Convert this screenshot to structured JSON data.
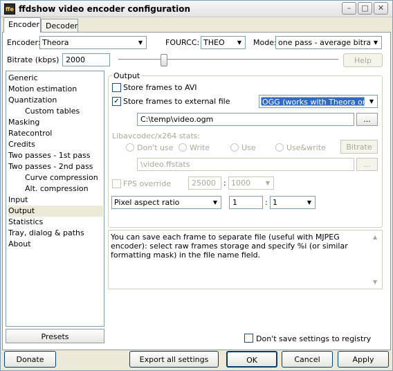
{
  "window": {
    "title": "ffdshow video encoder configuration",
    "icon_text": "ffe"
  },
  "tabs": [
    "Encoder",
    "Decoder"
  ],
  "encoder": {
    "label": "Encoder:",
    "value": "Theora"
  },
  "fourcc": {
    "label": "FOURCC:",
    "value": "THEO"
  },
  "mode": {
    "label": "Mode:",
    "value": "one pass - average bitrate"
  },
  "bitrate": {
    "label": "Bitrate (kbps)",
    "value": "2000",
    "help_label": "Help"
  },
  "tree": [
    "Generic",
    "Motion estimation",
    "Quantization",
    "Custom tables",
    "Masking",
    "Ratecontrol",
    "Credits",
    "Two passes - 1st pass",
    "Two passes - 2nd pass",
    "Curve compression",
    "Alt. compression",
    "Input",
    "Output",
    "Statistics",
    "Tray, dialog & paths",
    "About"
  ],
  "presets_label": "Presets",
  "output": {
    "group_title": "Output",
    "store_avi": "Store frames to AVI",
    "store_external": "Store frames to external file",
    "format": "OGG (works with Theora only)",
    "file_path": "C:\\temp\\video.ogm",
    "browse": "...",
    "stats_label": "Libavcodec/x264 stats:",
    "radio_dont_use": "Don't use",
    "radio_write": "Write",
    "radio_use": "Use",
    "radio_usewrite": "Use&write",
    "bitrate_btn": "Bitrate",
    "stats_path": "\\video.ffstats",
    "fps_override": "FPS override",
    "fps_num": "25000",
    "fps_colon": ":",
    "fps_den": "1000",
    "aspect": "Pixel aspect ratio",
    "aspect_num": "1",
    "aspect_colon": ":",
    "aspect_den": "1"
  },
  "description": "You can save each frame to separate file (useful with MJPEG encoder): select raw frames storage and specify %i (or similar formatting mask) in the file name field.",
  "dont_save": "Don't save settings to registry",
  "buttons": {
    "donate": "Donate",
    "export": "Export all settings",
    "ok": "OK",
    "cancel": "Cancel",
    "apply": "Apply"
  },
  "icons": {
    "minimize": "minimize-icon",
    "maximize": "maximize-icon",
    "close": "close-icon",
    "dropdown": "chevron-down-icon",
    "check": "checkmark-icon"
  }
}
